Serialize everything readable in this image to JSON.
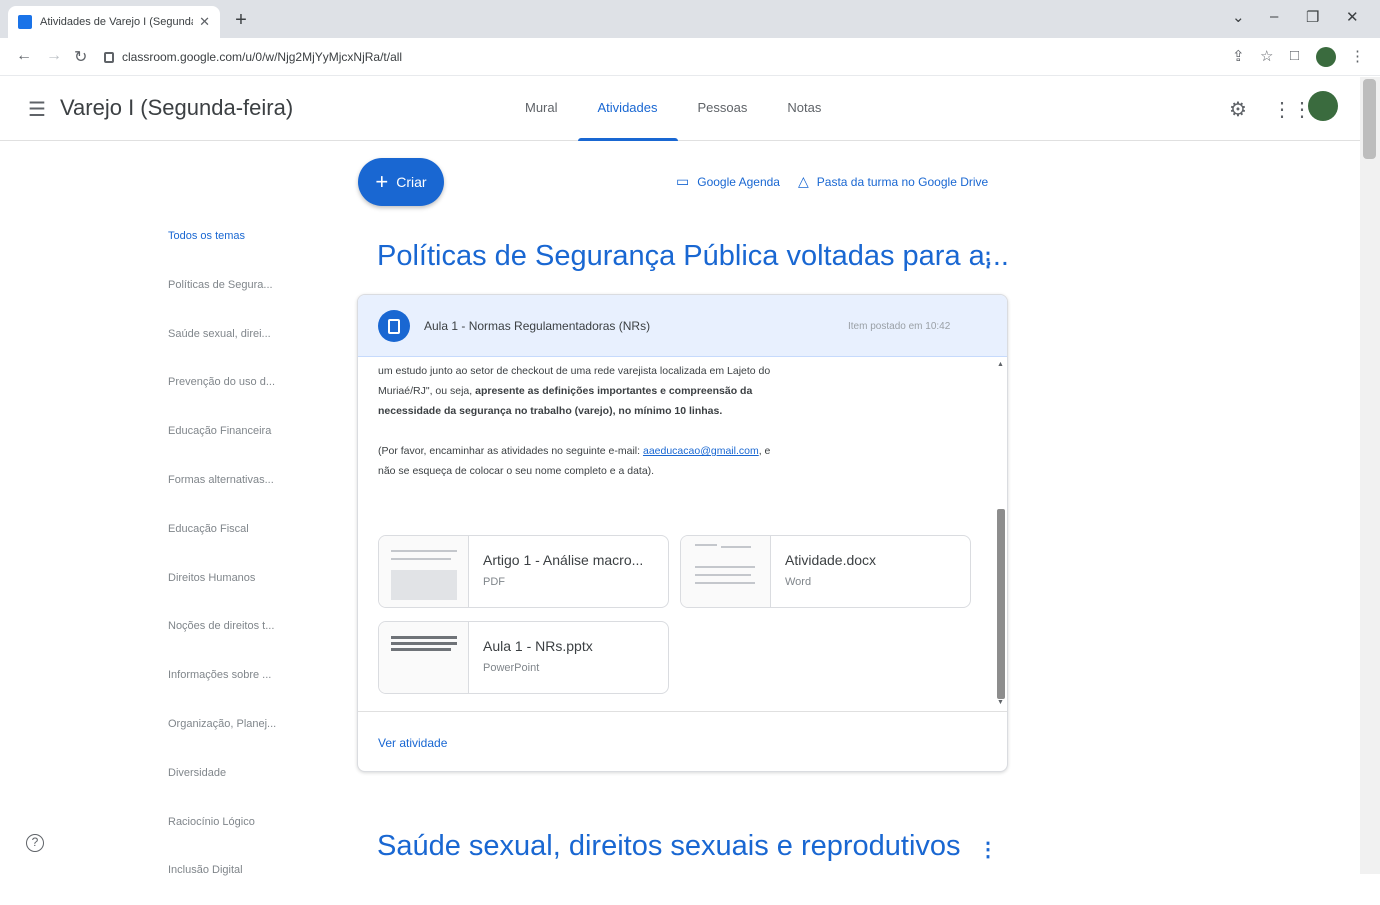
{
  "browser": {
    "tab_title": "Atividades de Varejo I (Segunda-",
    "url": "classroom.google.com/u/0/w/Njg2MjYyMjcxNjRa/t/all"
  },
  "header": {
    "class_name": "Varejo I (Segunda-feira)",
    "tabs": [
      "Mural",
      "Atividades",
      "Pessoas",
      "Notas"
    ],
    "active_tab": "Atividades"
  },
  "actions": {
    "create_label": "Criar",
    "calendar_link": "Google Agenda",
    "drive_link": "Pasta da turma no Google Drive"
  },
  "topics": [
    "Todos os temas",
    "Políticas de Segura...",
    "Saúde sexual, direi...",
    "Prevenção do uso d...",
    "Educação Financeira",
    "Formas alternativas...",
    "Educação Fiscal",
    "Direitos Humanos",
    "Noções de direitos t...",
    "Informações sobre ...",
    "Organização, Planej...",
    "Diversidade",
    "Raciocínio Lógico",
    "Inclusão Digital"
  ],
  "sections": [
    {
      "title": "Políticas de Segurança Pública voltadas para a..."
    },
    {
      "title": "Saúde sexual, direitos sexuais e reprodutivos"
    }
  ],
  "assignment": {
    "title": "Aula 1 - Normas Regulamentadoras (NRs)",
    "meta": "Item postado em 10:42",
    "body_1": "um estudo junto ao setor de checkout de uma rede varejista localizada em Lajeto do Muriaé/RJ\", ou seja,",
    "body_bold": "apresente as definições importantes e compreensão da necessidade da segurança no trabalho (varejo), no mínimo 10 linhas.",
    "body_2": "(Por favor, encaminhar as atividades no seguinte e-mail:",
    "email": "aaeducacao@gmail.com",
    "body_3": ", e não se esqueça de colocar o seu nome completo e a data).",
    "attachments": [
      {
        "name": "Artigo 1 - Análise macro...",
        "kind": "PDF"
      },
      {
        "name": "Atividade.docx",
        "kind": "Word"
      },
      {
        "name": "Aula 1 - NRs.pptx",
        "kind": "PowerPoint"
      }
    ],
    "view_link": "Ver atividade"
  }
}
